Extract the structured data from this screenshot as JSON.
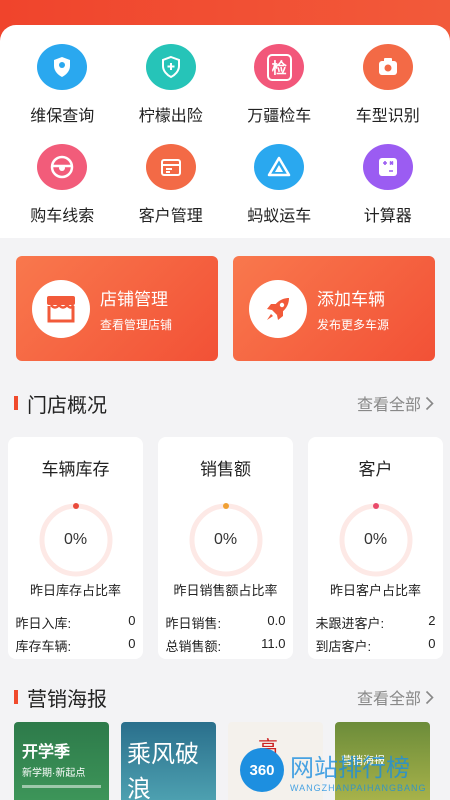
{
  "grid": [
    {
      "label": "维保查询",
      "icon": "shield-person-icon",
      "color": "#2aa8ef"
    },
    {
      "label": "柠檬出险",
      "icon": "shield-plus-icon",
      "color": "#26c4b8"
    },
    {
      "label": "万疆检车",
      "icon": "inspect-icon",
      "icon_text": "检",
      "color": "#f2577a"
    },
    {
      "label": "车型识别",
      "icon": "camera-icon",
      "color": "#f36a46"
    },
    {
      "label": "购车线索",
      "icon": "steering-wheel-icon",
      "color": "#f25c7a"
    },
    {
      "label": "客户管理",
      "icon": "calendar-icon",
      "color": "#f36a46"
    },
    {
      "label": "蚂蚁运车",
      "icon": "triangle-icon",
      "color": "#2aa8ef"
    },
    {
      "label": "计算器",
      "icon": "calculator-icon",
      "color": "#9b5cf2"
    }
  ],
  "promos": [
    {
      "title": "店铺管理",
      "subtitle": "查看管理店铺",
      "icon": "store-icon"
    },
    {
      "title": "添加车辆",
      "subtitle": "发布更多车源",
      "icon": "rocket-icon"
    }
  ],
  "overview": {
    "title": "门店概况",
    "more": "查看全部",
    "stats": [
      {
        "title": "车辆库存",
        "value": "0%",
        "caption": "昨日库存占比率",
        "dot": "#e94a3a",
        "rows": [
          {
            "label": "昨日入库:",
            "value": "0"
          },
          {
            "label": "库存车辆:",
            "value": "0"
          }
        ]
      },
      {
        "title": "销售额",
        "value": "0%",
        "caption": "昨日销售额占比率",
        "dot": "#f0a033",
        "rows": [
          {
            "label": "昨日销售:",
            "value": "0.0"
          },
          {
            "label": "总销售额:",
            "value": "11.0"
          }
        ]
      },
      {
        "title": "客户",
        "value": "0%",
        "caption": "昨日客户占比率",
        "dot": "#e94a6a",
        "rows": [
          {
            "label": "未跟进客户:",
            "value": "2"
          },
          {
            "label": "到店客户:",
            "value": "0"
          }
        ]
      }
    ]
  },
  "marketing": {
    "title": "营销海报",
    "more": "查看全部",
    "posters": [
      {
        "title": "开学季",
        "subtitle": "新学期·新起点"
      },
      {
        "title": "乘风破浪"
      },
      {
        "title": "高"
      },
      {
        "title": "营销海报"
      }
    ]
  },
  "watermark": {
    "badge": "360",
    "main": "网站排行榜",
    "sub": "WANGZHANPAIHANGBANG"
  }
}
